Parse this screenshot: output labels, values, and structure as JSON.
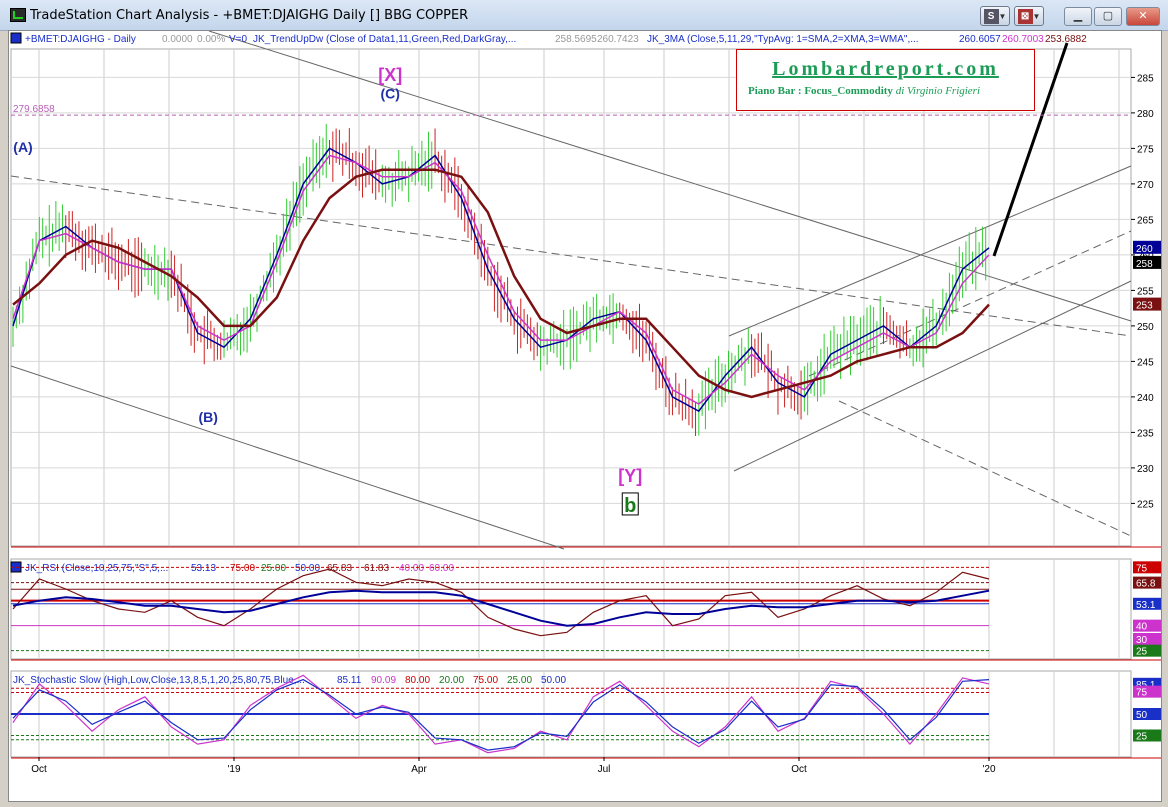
{
  "window": {
    "title": "TradeStation Chart Analysis - +BMET:DJAIGHG Daily [] BBG COPPER",
    "buttons": [
      "S",
      "⊠"
    ]
  },
  "header": {
    "symbol": "+BMET:DJAIGHG - Daily",
    "vals": [
      "0.0000",
      "0.00%",
      "V=0"
    ],
    "trend_study": "JK_TrendUpDw (Close of Data1,11,Green,Red,DarkGray,...",
    "trend_vals": [
      "258.5695",
      "260.7423"
    ],
    "ma_study": "JK_3MA (Close,5,11,29,\"TypAvg: 1=SMA,2=XMA,3=WMA\",...",
    "ma_vals": [
      "260.6057",
      "260.7003",
      "253.6882"
    ]
  },
  "logo": {
    "title": "Lombardreport.com",
    "subtitle": "Piano Bar : Focus_Commodity",
    "author": "di Virginio Frigieri"
  },
  "colors": {
    "price_up": "#33cc33",
    "price_down": "#cc2222",
    "ma_fast": "#000099",
    "ma_mid": "#cc33cc",
    "ma_slow": "#7a1010",
    "wave_blue": "#1f2fa8",
    "wave_magenta": "#cc33cc",
    "wave_green": "#1a7a1a"
  },
  "chart_data": [
    {
      "type": "line",
      "panel": "price",
      "ylim": [
        219,
        289
      ],
      "ytick_labels": [
        "225",
        "230",
        "235",
        "240",
        "245",
        "250",
        "255",
        "260",
        "265",
        "270",
        "275",
        "280",
        "285"
      ],
      "xtick_labels": [
        "Oct",
        "'19",
        "Apr",
        "Jul",
        "Oct",
        "'20"
      ],
      "level_label": "279.6858",
      "level": 279.6858,
      "last_value_labels": [
        "260",
        "258",
        "253"
      ],
      "series": [
        {
          "role": "fast",
          "values": [
            250,
            262,
            264,
            261,
            259,
            258,
            258,
            249,
            247,
            251,
            260,
            270,
            275,
            273,
            270,
            271,
            274,
            268,
            258,
            251,
            247,
            248,
            251,
            252,
            248,
            240,
            238,
            243,
            247,
            242,
            240,
            246,
            248,
            250,
            247,
            250,
            258,
            261
          ]
        },
        {
          "role": "mid",
          "values": [
            251,
            262,
            263,
            261,
            259,
            258,
            258,
            250,
            248,
            250,
            259,
            269,
            274,
            273,
            271,
            271,
            273,
            269,
            260,
            252,
            248,
            248,
            250,
            252,
            249,
            241,
            239,
            242,
            246,
            243,
            241,
            245,
            247,
            249,
            247,
            249,
            256,
            260
          ]
        },
        {
          "role": "slow",
          "values": [
            253,
            256,
            260,
            262,
            261,
            259,
            257,
            254,
            250,
            250,
            254,
            262,
            268,
            271,
            272,
            272,
            272,
            271,
            266,
            257,
            251,
            249,
            250,
            251,
            251,
            247,
            243,
            241,
            240,
            241,
            242,
            243,
            245,
            246,
            247,
            247,
            249,
            253
          ]
        }
      ],
      "annotations": [
        {
          "text": "(A)",
          "x": 0,
          "y": 274.5,
          "color": "blue"
        },
        {
          "text": "(B)",
          "x": 7.4,
          "y": 236.5,
          "color": "blue"
        },
        {
          "text": "(C)",
          "x": 14.3,
          "y": 282,
          "color": "blue"
        },
        {
          "text": "[X]",
          "x": 14.3,
          "y": 284.5,
          "color": "magenta"
        },
        {
          "text": "[Y]",
          "x": 23.4,
          "y": 228,
          "color": "magenta"
        },
        {
          "text": "b",
          "x": 23.4,
          "y": 224.5,
          "color": "green"
        }
      ]
    },
    {
      "type": "line",
      "panel": "rsi",
      "title": "JK_RSI (Close,10,25,75,\"S\",5,...",
      "header_values": [
        "53.13",
        "75.00",
        "25.00",
        "50.00",
        "65.83",
        "61.83",
        "40.00",
        "60.00"
      ],
      "ylim": [
        20,
        80
      ],
      "levels": [
        75,
        65.83,
        61.83,
        53.13,
        40,
        25
      ],
      "right_labels": [
        "75",
        "65.8",
        "53.1",
        "40",
        "30",
        "25"
      ],
      "series": [
        {
          "role": "rsi",
          "values": [
            50,
            68,
            62,
            55,
            50,
            48,
            55,
            45,
            40,
            50,
            62,
            70,
            74,
            66,
            64,
            68,
            66,
            60,
            45,
            38,
            34,
            36,
            48,
            55,
            58,
            40,
            44,
            58,
            60,
            45,
            50,
            58,
            64,
            56,
            52,
            60,
            72,
            68
          ]
        },
        {
          "role": "rsi_avg",
          "values": [
            52,
            55,
            57,
            56,
            54,
            52,
            52,
            50,
            48,
            49,
            53,
            57,
            60,
            61,
            60,
            60,
            60,
            58,
            53,
            48,
            43,
            40,
            41,
            45,
            48,
            47,
            47,
            50,
            52,
            51,
            51,
            53,
            55,
            55,
            54,
            55,
            58,
            61
          ]
        }
      ]
    },
    {
      "type": "line",
      "panel": "stochastic",
      "title": "JK_Stochastic Slow (High,Low,Close,13,8,5,1,20,25,80,75,Blue,...",
      "header_values": [
        "85.11",
        "90.09",
        "80.00",
        "20.00",
        "75.00",
        "25.00",
        "50.00"
      ],
      "ylim": [
        0,
        100
      ],
      "levels": [
        80,
        75,
        50,
        25,
        20
      ],
      "right_labels": [
        "85.1",
        "75",
        "50",
        "25"
      ],
      "series": [
        {
          "role": "k",
          "values": [
            40,
            85,
            60,
            30,
            55,
            70,
            35,
            15,
            20,
            60,
            80,
            95,
            70,
            45,
            60,
            50,
            15,
            20,
            5,
            10,
            30,
            20,
            70,
            88,
            60,
            30,
            12,
            35,
            70,
            30,
            45,
            88,
            80,
            50,
            15,
            50,
            92,
            85
          ]
        },
        {
          "role": "d",
          "values": [
            45,
            78,
            65,
            38,
            52,
            65,
            40,
            20,
            22,
            55,
            78,
            90,
            72,
            50,
            58,
            52,
            22,
            20,
            8,
            12,
            28,
            24,
            64,
            84,
            64,
            35,
            16,
            32,
            65,
            35,
            44,
            84,
            82,
            55,
            20,
            46,
            88,
            90
          ]
        }
      ]
    }
  ]
}
